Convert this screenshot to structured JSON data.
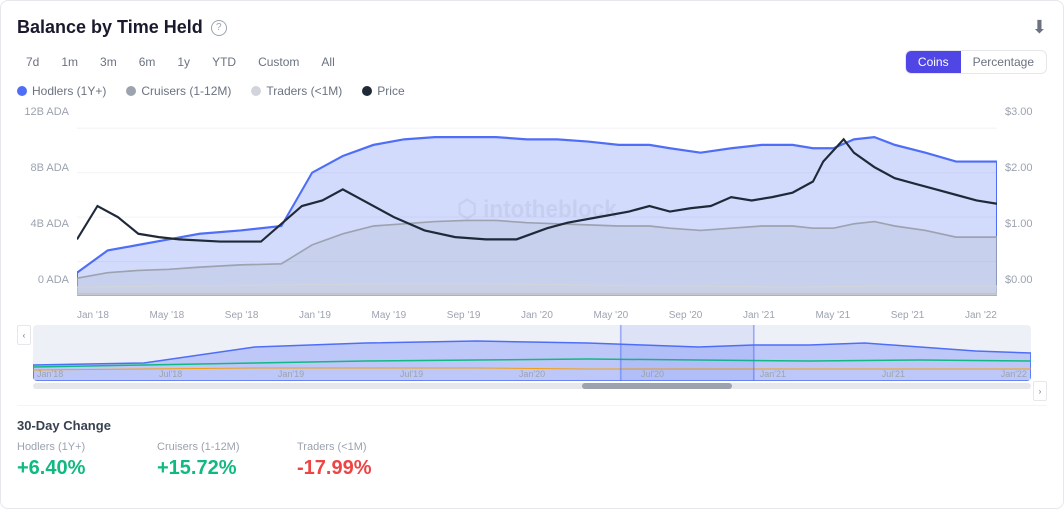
{
  "title": "Balance by Time Held",
  "timeFilters": [
    "7d",
    "1m",
    "3m",
    "6m",
    "1y",
    "YTD",
    "Custom",
    "All"
  ],
  "viewToggle": {
    "options": [
      "Coins",
      "Percentage"
    ],
    "active": "Coins"
  },
  "legend": [
    {
      "label": "Hodlers (1Y+)",
      "color": "#4f6ef7",
      "type": "filled"
    },
    {
      "label": "Cruisers (1-12M)",
      "color": "#9ca3af",
      "type": "filled"
    },
    {
      "label": "Traders (<1M)",
      "color": "#d1d5db",
      "type": "filled"
    },
    {
      "label": "Price",
      "color": "#1f2937",
      "type": "filled"
    }
  ],
  "yAxisLeft": [
    "12B ADA",
    "8B ADA",
    "4B ADA",
    "0 ADA"
  ],
  "yAxisRight": [
    "$3.00",
    "$2.00",
    "$1.00",
    "$0.00"
  ],
  "xAxisLabels": [
    "Jan '18",
    "May '18",
    "Sep '18",
    "Jan '19",
    "May '19",
    "Sep '19",
    "Jan '20",
    "May '20",
    "Sep '20",
    "Jan '21",
    "May '21",
    "Sep '21",
    "Jan '22"
  ],
  "miniChartLabels": [
    "Jan'18",
    "Jul'18",
    "Jan'19",
    "Jul'19",
    "Jan'20",
    "Jul'20",
    "Jan'21",
    "Jul'21",
    "Jan'22"
  ],
  "stats": {
    "title": "30-Day Change",
    "items": [
      {
        "header": "Hodlers (1Y+)",
        "value": "+6.40%",
        "type": "positive"
      },
      {
        "header": "Cruisers (1-12M)",
        "value": "+15.72%",
        "type": "positive"
      },
      {
        "header": "Traders (<1M)",
        "value": "-17.99%",
        "type": "negative"
      }
    ]
  },
  "watermark": "intotheblock"
}
